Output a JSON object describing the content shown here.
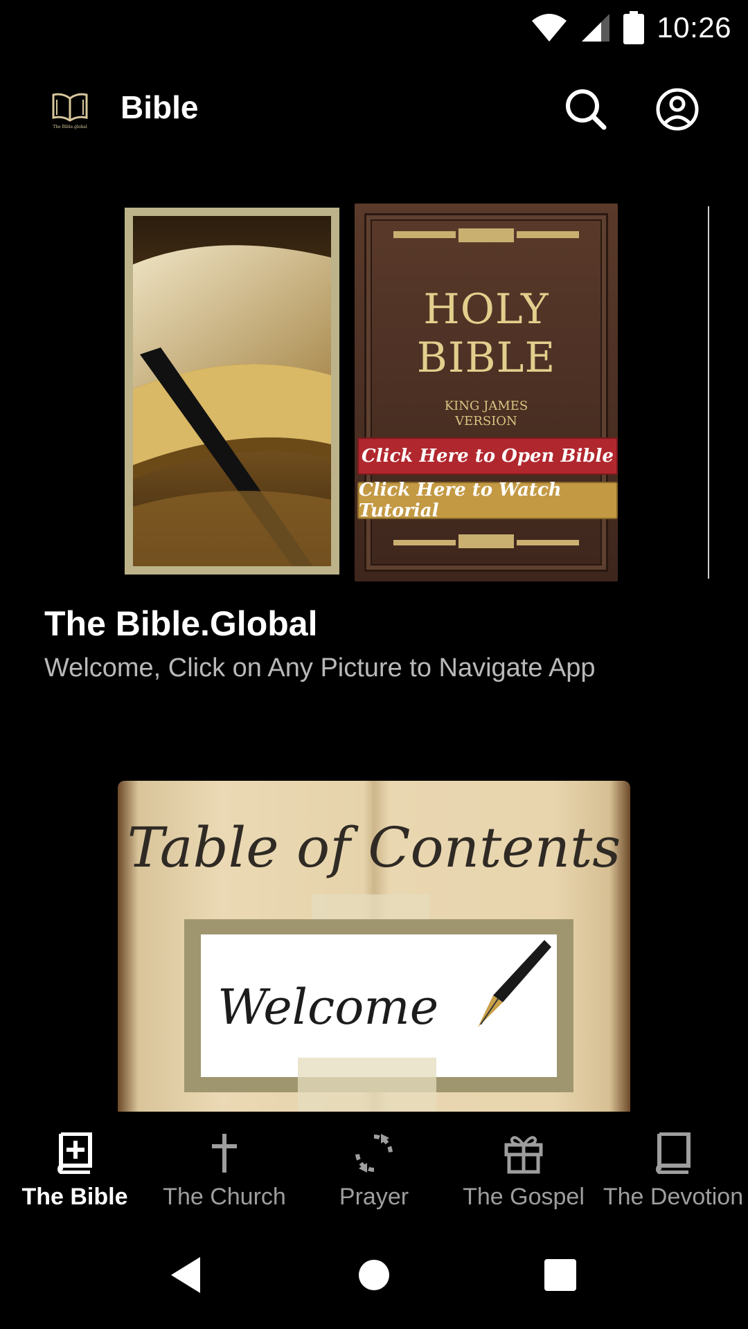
{
  "status_bar": {
    "time": "10:26"
  },
  "app_bar": {
    "title": "Bible",
    "logo_caption": "The Bible.global"
  },
  "banner": {
    "cover_title_line1": "HOLY",
    "cover_title_line2": "BIBLE",
    "cover_subtitle_line1": "KING JAMES",
    "cover_subtitle_line2": "VERSION",
    "open_button": "Click Here to Open Bible",
    "tutorial_button": "Click Here to Watch Tutorial"
  },
  "section": {
    "title": "The Bible.Global",
    "subtitle": "Welcome, Click on Any Picture to Navigate App"
  },
  "toc_image": {
    "title": "Table of Contents",
    "welcome": "Welcome"
  },
  "bottom_nav": {
    "items": [
      {
        "label": "The Bible",
        "icon": "bible-plus-icon",
        "active": true
      },
      {
        "label": "The Church",
        "icon": "cross-icon",
        "active": false
      },
      {
        "label": "Prayer",
        "icon": "refresh-icon",
        "active": false
      },
      {
        "label": "The Gospel",
        "icon": "gift-icon",
        "active": false
      },
      {
        "label": "The Devotion",
        "icon": "book-icon",
        "active": false
      }
    ]
  },
  "colors": {
    "background": "#000000",
    "active_text": "#ffffff",
    "inactive_text": "#9e9e9e",
    "subtitle_text": "#b9b9b9",
    "open_button": "#b1272e",
    "tutorial_button": "#c39943"
  }
}
